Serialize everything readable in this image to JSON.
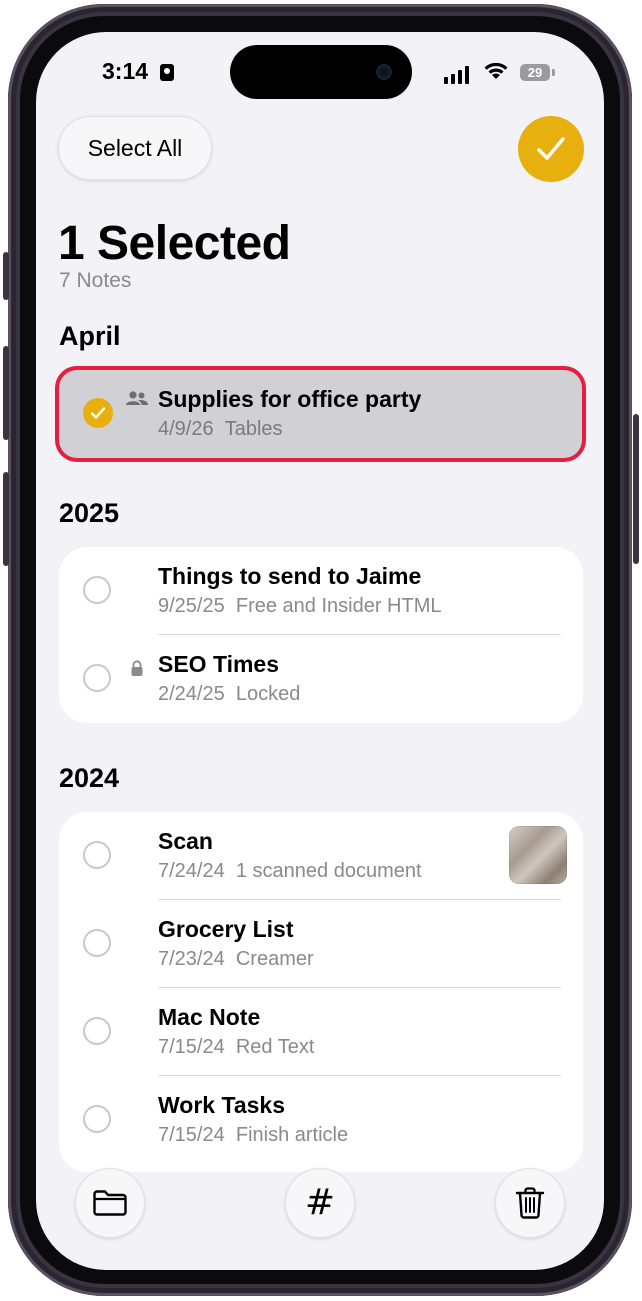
{
  "status_bar": {
    "time": "3:14",
    "battery": "29"
  },
  "header": {
    "select_all_label": "Select All"
  },
  "title": "1 Selected",
  "subtitle": "7 Notes",
  "sections": [
    {
      "heading": "April",
      "notes": [
        {
          "title": "Supplies for office party",
          "date": "4/9/26",
          "preview": "Tables",
          "selected": true,
          "shared": true
        }
      ]
    },
    {
      "heading": "2025",
      "notes": [
        {
          "title": "Things to send to Jaime",
          "date": "9/25/25",
          "preview": "Free and Insider HTML"
        },
        {
          "title": "SEO Times",
          "date": "2/24/25",
          "preview": "Locked",
          "locked": true
        }
      ]
    },
    {
      "heading": "2024",
      "notes": [
        {
          "title": "Scan",
          "date": "7/24/24",
          "preview": "1 scanned document",
          "thumbnail": true
        },
        {
          "title": "Grocery List",
          "date": "7/23/24",
          "preview": "Creamer"
        },
        {
          "title": "Mac Note",
          "date": "7/15/24",
          "preview": "Red Text"
        },
        {
          "title": "Work Tasks",
          "date": "7/15/24",
          "preview": "Finish article"
        }
      ]
    }
  ],
  "toolbar": {
    "move_icon": "folder-icon",
    "tag_icon": "hashtag-icon",
    "delete_icon": "trash-icon",
    "hash_glyph": "#"
  },
  "colors": {
    "accent": "#e7b00e",
    "highlight": "#e3203f",
    "background": "#f2f2f7"
  }
}
